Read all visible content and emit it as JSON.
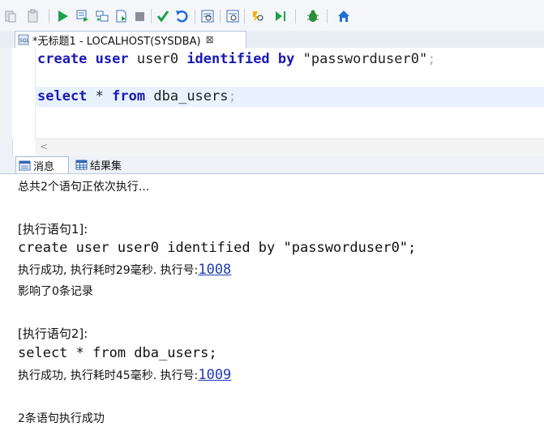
{
  "toolbar": {
    "buttons": [
      "cut-icon",
      "paste-icon",
      "run-icon",
      "run-step-icon",
      "run-selection-icon",
      "run-script-icon",
      "stop-icon",
      "commit-icon",
      "rollback-icon",
      "format-icon",
      "execution-plan-icon",
      "debug-step-icon",
      "run-to-cursor-icon",
      "bug-icon",
      "home-icon"
    ],
    "corner_text": "(•)"
  },
  "editor_tab": {
    "title": "*无标题1 - LOCALHOST(SYSDBA)",
    "close": "⊠",
    "icon": "sql-file-icon"
  },
  "editor": {
    "line1": {
      "kw1": "create",
      "kw2": "user",
      "ident": "user0",
      "kw3": "identified",
      "kw4": "by",
      "str": "\"passworduser0\"",
      "semi": ";"
    },
    "line2": {
      "kw1": "select",
      "star": "*",
      "kw2": "from",
      "ident": "dba_users",
      "semi": ";"
    },
    "scroll_left": "<"
  },
  "result_tabs": [
    {
      "label": "消息",
      "icon": "message-icon",
      "active": true
    },
    {
      "label": "结果集",
      "icon": "table-icon",
      "active": false
    }
  ],
  "messages": {
    "header": "总共2个语句正依次执行...",
    "stmt1_label": "[执行语句1]:",
    "stmt1_sql": "create user user0 identified by \"passworduser0\";",
    "stmt1_result": "执行成功, 执行耗时29毫秒. 执行号:",
    "stmt1_exec_no": "1008",
    "stmt1_rows": "影响了0条记录",
    "stmt2_label": "[执行语句2]:",
    "stmt2_sql": "select * from dba_users;",
    "stmt2_result": "执行成功, 执行耗时45毫秒. 执行号:",
    "stmt2_exec_no": "1009",
    "summary": "2条语句执行成功"
  },
  "colors": {
    "keyword": "#1a1ab3",
    "link": "#1f3bb0",
    "accent_green": "#19a34a",
    "accent_blue": "#1e6fd9"
  }
}
